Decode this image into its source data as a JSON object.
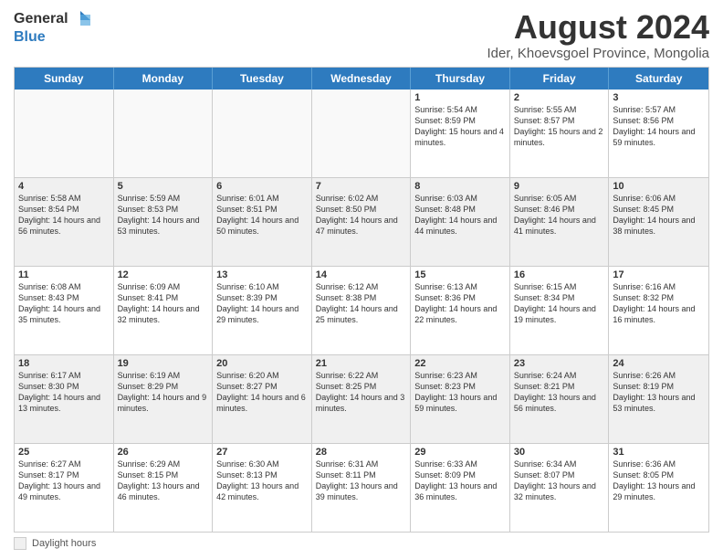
{
  "logo": {
    "line1": "General",
    "line2": "Blue"
  },
  "header": {
    "title": "August 2024",
    "subtitle": "Ider, Khoevsgoel Province, Mongolia"
  },
  "days": [
    "Sunday",
    "Monday",
    "Tuesday",
    "Wednesday",
    "Thursday",
    "Friday",
    "Saturday"
  ],
  "footer": {
    "label": "Daylight hours"
  },
  "rows": [
    [
      {
        "day": "",
        "content": ""
      },
      {
        "day": "",
        "content": ""
      },
      {
        "day": "",
        "content": ""
      },
      {
        "day": "",
        "content": ""
      },
      {
        "day": "1",
        "content": "Sunrise: 5:54 AM\nSunset: 8:59 PM\nDaylight: 15 hours and 4 minutes."
      },
      {
        "day": "2",
        "content": "Sunrise: 5:55 AM\nSunset: 8:57 PM\nDaylight: 15 hours and 2 minutes."
      },
      {
        "day": "3",
        "content": "Sunrise: 5:57 AM\nSunset: 8:56 PM\nDaylight: 14 hours and 59 minutes."
      }
    ],
    [
      {
        "day": "4",
        "content": "Sunrise: 5:58 AM\nSunset: 8:54 PM\nDaylight: 14 hours and 56 minutes."
      },
      {
        "day": "5",
        "content": "Sunrise: 5:59 AM\nSunset: 8:53 PM\nDaylight: 14 hours and 53 minutes."
      },
      {
        "day": "6",
        "content": "Sunrise: 6:01 AM\nSunset: 8:51 PM\nDaylight: 14 hours and 50 minutes."
      },
      {
        "day": "7",
        "content": "Sunrise: 6:02 AM\nSunset: 8:50 PM\nDaylight: 14 hours and 47 minutes."
      },
      {
        "day": "8",
        "content": "Sunrise: 6:03 AM\nSunset: 8:48 PM\nDaylight: 14 hours and 44 minutes."
      },
      {
        "day": "9",
        "content": "Sunrise: 6:05 AM\nSunset: 8:46 PM\nDaylight: 14 hours and 41 minutes."
      },
      {
        "day": "10",
        "content": "Sunrise: 6:06 AM\nSunset: 8:45 PM\nDaylight: 14 hours and 38 minutes."
      }
    ],
    [
      {
        "day": "11",
        "content": "Sunrise: 6:08 AM\nSunset: 8:43 PM\nDaylight: 14 hours and 35 minutes."
      },
      {
        "day": "12",
        "content": "Sunrise: 6:09 AM\nSunset: 8:41 PM\nDaylight: 14 hours and 32 minutes."
      },
      {
        "day": "13",
        "content": "Sunrise: 6:10 AM\nSunset: 8:39 PM\nDaylight: 14 hours and 29 minutes."
      },
      {
        "day": "14",
        "content": "Sunrise: 6:12 AM\nSunset: 8:38 PM\nDaylight: 14 hours and 25 minutes."
      },
      {
        "day": "15",
        "content": "Sunrise: 6:13 AM\nSunset: 8:36 PM\nDaylight: 14 hours and 22 minutes."
      },
      {
        "day": "16",
        "content": "Sunrise: 6:15 AM\nSunset: 8:34 PM\nDaylight: 14 hours and 19 minutes."
      },
      {
        "day": "17",
        "content": "Sunrise: 6:16 AM\nSunset: 8:32 PM\nDaylight: 14 hours and 16 minutes."
      }
    ],
    [
      {
        "day": "18",
        "content": "Sunrise: 6:17 AM\nSunset: 8:30 PM\nDaylight: 14 hours and 13 minutes."
      },
      {
        "day": "19",
        "content": "Sunrise: 6:19 AM\nSunset: 8:29 PM\nDaylight: 14 hours and 9 minutes."
      },
      {
        "day": "20",
        "content": "Sunrise: 6:20 AM\nSunset: 8:27 PM\nDaylight: 14 hours and 6 minutes."
      },
      {
        "day": "21",
        "content": "Sunrise: 6:22 AM\nSunset: 8:25 PM\nDaylight: 14 hours and 3 minutes."
      },
      {
        "day": "22",
        "content": "Sunrise: 6:23 AM\nSunset: 8:23 PM\nDaylight: 13 hours and 59 minutes."
      },
      {
        "day": "23",
        "content": "Sunrise: 6:24 AM\nSunset: 8:21 PM\nDaylight: 13 hours and 56 minutes."
      },
      {
        "day": "24",
        "content": "Sunrise: 6:26 AM\nSunset: 8:19 PM\nDaylight: 13 hours and 53 minutes."
      }
    ],
    [
      {
        "day": "25",
        "content": "Sunrise: 6:27 AM\nSunset: 8:17 PM\nDaylight: 13 hours and 49 minutes."
      },
      {
        "day": "26",
        "content": "Sunrise: 6:29 AM\nSunset: 8:15 PM\nDaylight: 13 hours and 46 minutes."
      },
      {
        "day": "27",
        "content": "Sunrise: 6:30 AM\nSunset: 8:13 PM\nDaylight: 13 hours and 42 minutes."
      },
      {
        "day": "28",
        "content": "Sunrise: 6:31 AM\nSunset: 8:11 PM\nDaylight: 13 hours and 39 minutes."
      },
      {
        "day": "29",
        "content": "Sunrise: 6:33 AM\nSunset: 8:09 PM\nDaylight: 13 hours and 36 minutes."
      },
      {
        "day": "30",
        "content": "Sunrise: 6:34 AM\nSunset: 8:07 PM\nDaylight: 13 hours and 32 minutes."
      },
      {
        "day": "31",
        "content": "Sunrise: 6:36 AM\nSunset: 8:05 PM\nDaylight: 13 hours and 29 minutes."
      }
    ]
  ]
}
